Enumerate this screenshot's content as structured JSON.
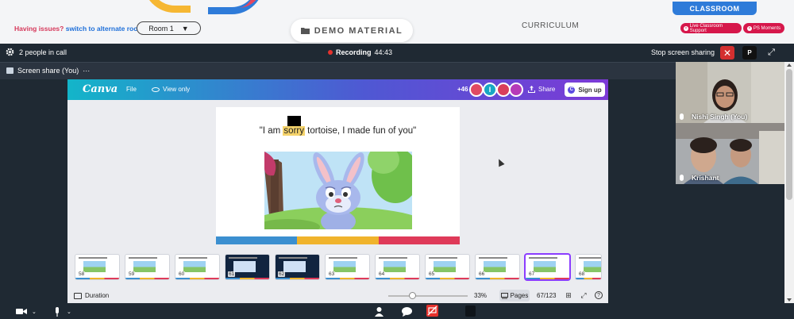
{
  "header": {
    "issues_label": "Having issues?",
    "alt_room_link": "switch to alternate room",
    "room_select": "Room 1",
    "demo_material": "DEMO MATERIAL",
    "curriculum": "CURRICULUM",
    "classroom": "CLASSROOM",
    "support_pill": "Live Classroom Support",
    "moments_pill": "PS Moments"
  },
  "callbar": {
    "people": "2 people in call",
    "recording_label": "Recording",
    "recording_time": "44:43",
    "stop_share": "Stop screen sharing",
    "p_button": "P"
  },
  "share_tab": {
    "label": "Screen share (You)",
    "more": "···"
  },
  "canva": {
    "logo": "Canva",
    "file": "File",
    "view_only": "View only",
    "extra_count": "+46",
    "avatar_letter": "I",
    "share": "Share",
    "sign_up": "Sign up",
    "slide_caption_pre": "\"I am ",
    "slide_caption_hl": "sorry",
    "slide_caption_post": " tortoise, I made fun of you\"",
    "thumbnails": [
      "58",
      "59",
      "60",
      "61",
      "62",
      "63",
      "64",
      "65",
      "66",
      "67",
      "68"
    ],
    "duration": "Duration",
    "zoom": "33%",
    "pages": "Pages",
    "page_count": "67/123",
    "colors": {
      "blue": "#3b8fd0",
      "yellow": "#f0b32c",
      "red": "#df3a59"
    }
  },
  "participants": [
    {
      "name": "Nishi Singh (You)"
    },
    {
      "name": "Krishant"
    }
  ]
}
